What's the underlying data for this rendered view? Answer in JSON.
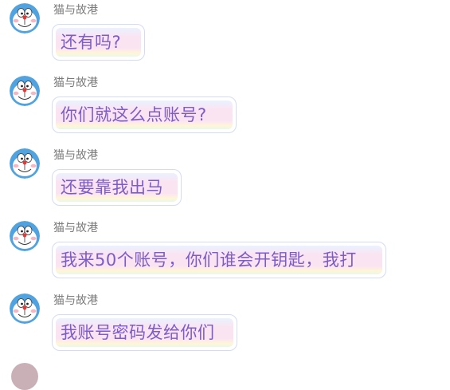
{
  "chat": {
    "messages": [
      {
        "sender": "猫与故港",
        "text": "还有吗?"
      },
      {
        "sender": "猫与故港",
        "text": "你们就这么点账号?"
      },
      {
        "sender": "猫与故港",
        "text": "还要靠我出马"
      },
      {
        "sender": "猫与故港",
        "text": "我来50个账号，你们谁会开钥匙，我打"
      },
      {
        "sender": "猫与故港",
        "text": "我账号密码发给你们"
      }
    ]
  },
  "icons": {
    "avatar": "doraemon-avatar-icon"
  },
  "colors": {
    "bubble_text": "#7b5cc8",
    "sender_name": "#7a7a7a",
    "bubble_border": "#d4dcf2"
  }
}
